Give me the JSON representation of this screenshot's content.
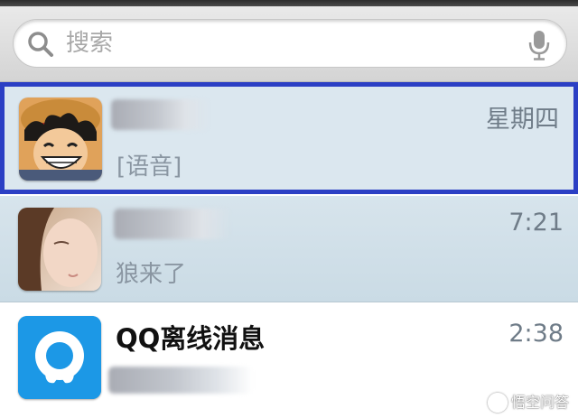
{
  "search": {
    "placeholder": "搜索",
    "icons": {
      "left": "search-icon",
      "right": "microphone-icon"
    }
  },
  "conversations": [
    {
      "name": "",
      "time": "星期四",
      "preview": "[语音]",
      "avatar": "anime-character-avatar",
      "selected": true
    },
    {
      "name": "",
      "time": "7:21",
      "preview": "狼来了",
      "avatar": "girl-photo-avatar",
      "selected": false
    },
    {
      "name": "QQ离线消息",
      "time": "2:38",
      "preview": "",
      "avatar": "qq-penguin-avatar",
      "selected": false
    }
  ],
  "watermark": {
    "text": "悟空问答",
    "icon": "wukong-logo-icon"
  },
  "colors": {
    "selection_border": "#2b3fc4",
    "qq_blue": "#1c98e6",
    "row_tint": "#dbe7ef"
  }
}
